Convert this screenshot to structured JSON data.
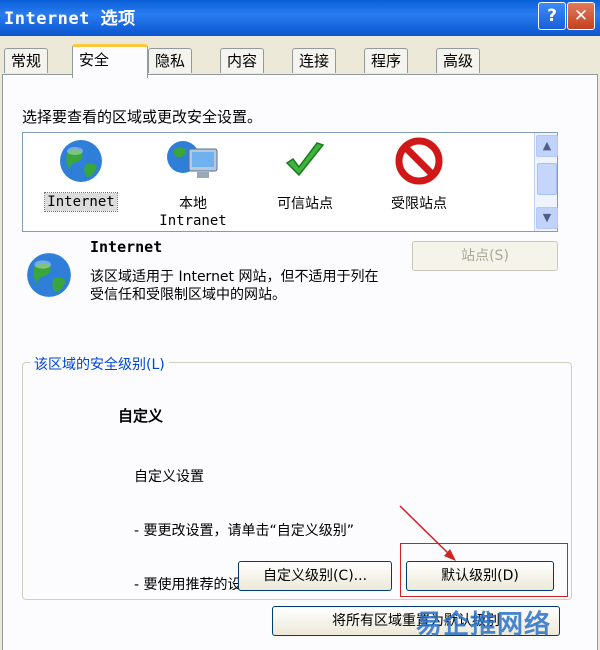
{
  "window": {
    "title": "Internet 选项",
    "help_label": "?",
    "close_label": "✕"
  },
  "tabs": [
    "常规",
    "安全",
    "隐私",
    "内容",
    "连接",
    "程序",
    "高级"
  ],
  "prompt": "选择要查看的区域或更改安全设置。",
  "zones": [
    {
      "label": "Internet",
      "icon": "globe-icon"
    },
    {
      "label": "本地",
      "label2": "Intranet",
      "icon": "computer-globe-icon"
    },
    {
      "label": "可信站点",
      "icon": "checkmark-icon"
    },
    {
      "label": "受限站点",
      "icon": "no-entry-icon"
    }
  ],
  "selected_zone": {
    "title": "Internet",
    "description": "该区域适用于 Internet 网站，但不适用于列在受信任和受限制区域中的网站。"
  },
  "sites_button": "站点(S)",
  "security_level": {
    "legend": "该区域的安全级别(L)",
    "title": "自定义",
    "lines": [
      "自定义设置",
      "- 要更改设置，请单击“自定义级别”",
      "- 要使用推荐的设置，请单击“默认级别”"
    ]
  },
  "buttons": {
    "custom_level": "自定义级别(C)...",
    "default_level": "默认级别(D)",
    "reset_all": "将所有区域重置为默认级别"
  },
  "watermark": "易企推网络",
  "colors": {
    "titlebar": "#0a5fd8",
    "tab_highlight": "#ffc73c",
    "legend_text": "#0046d5",
    "annotation": "#d42020"
  }
}
